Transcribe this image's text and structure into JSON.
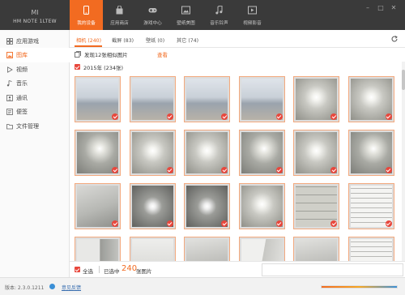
{
  "brand": {
    "logo_text": "MI",
    "device": "HM NOTE 1LTEW"
  },
  "nav": [
    {
      "label": "我的设备",
      "icon": "phone-icon",
      "active": true
    },
    {
      "label": "应用商店",
      "icon": "bag-icon",
      "active": false
    },
    {
      "label": "游戏中心",
      "icon": "gamepad-icon",
      "active": false
    },
    {
      "label": "壁纸美图",
      "icon": "picture-icon",
      "active": false
    },
    {
      "label": "音乐铃声",
      "icon": "music-note-icon",
      "active": false
    },
    {
      "label": "视频影音",
      "icon": "video-icon",
      "active": false
    }
  ],
  "window_controls": [
    "minimize-icon",
    "maximize-icon",
    "close-icon"
  ],
  "sidebar": {
    "items": [
      {
        "label": "应用游戏",
        "icon": "apps-icon",
        "active": false
      },
      {
        "label": "图库",
        "icon": "gallery-icon",
        "active": true
      },
      {
        "label": "视频",
        "icon": "play-icon",
        "active": false
      },
      {
        "label": "音乐",
        "icon": "music-icon",
        "active": false
      },
      {
        "label": "通讯",
        "icon": "contacts-icon",
        "active": false
      },
      {
        "label": "便签",
        "icon": "note-icon",
        "active": false
      },
      {
        "label": "文件管理",
        "icon": "folder-icon",
        "active": false
      }
    ]
  },
  "tabs": [
    {
      "label": "相机 (240)",
      "active": true
    },
    {
      "label": "截屏 (83)",
      "active": false
    },
    {
      "label": "壁纸 (0)",
      "active": false
    },
    {
      "label": "其它 (74)",
      "active": false
    }
  ],
  "notice": {
    "text": "发现12张相似图片",
    "link": "查看"
  },
  "group": {
    "label": "2015年 (234张)"
  },
  "photos": [
    "seaside-photo",
    "seaside-photo",
    "seaside-photo",
    "seaside-photo",
    "ceiling-light-photo",
    "ceiling-light-photo",
    "wall-lamp-photo",
    "ceiling-light-photo",
    "ceiling-light-photo",
    "wall-lamp-photo",
    "ceiling-light-photo",
    "wall-lamp-photo",
    "ceiling-room-photo",
    "chandelier-photo",
    "chandelier-photo",
    "ceiling-light-photo",
    "tiles-photo",
    "document-photo",
    "doorway-photo",
    "wall-photo",
    "room-photo",
    "corner-photo",
    "room-photo",
    "document-photo"
  ],
  "colors": {
    "accent": "#f26b21",
    "checkbox": "#e8473c",
    "topbar": "#3a3a3a"
  },
  "actionbar": {
    "select_all": "全选",
    "selected_prefix": "已选中",
    "selected_count": "240",
    "selected_suffix": "张图片"
  },
  "statusbar": {
    "version": "版本: 2.3.0.1211",
    "feedback": "意见反馈"
  }
}
